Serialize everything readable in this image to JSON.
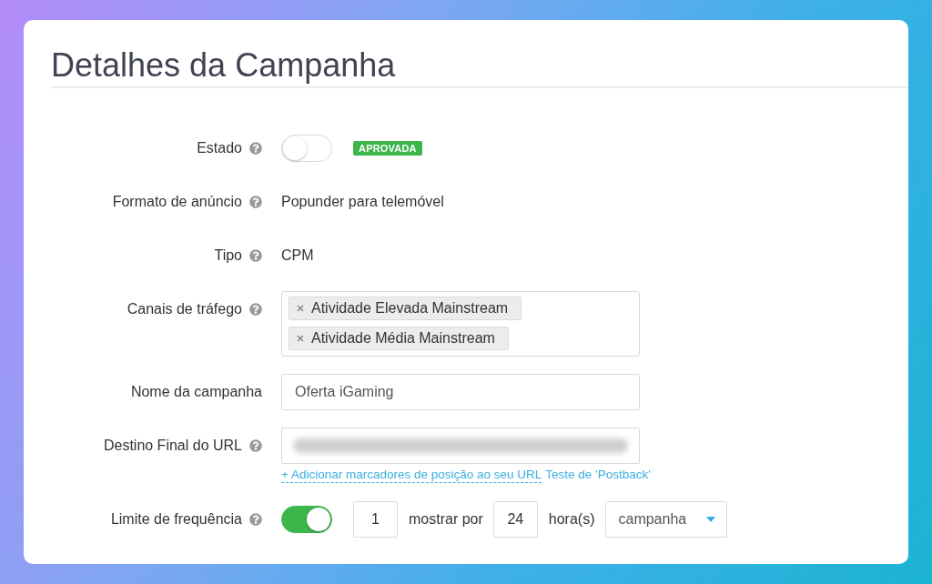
{
  "title": "Detalhes da Campanha",
  "rows": [
    {
      "kind": "toggle",
      "label": "Estado",
      "help": true,
      "on": false,
      "badge": "APROVADA"
    },
    {
      "kind": "text",
      "label": "Formato de anúncio",
      "help": true,
      "value": "Popunder para telemóvel"
    },
    {
      "kind": "text",
      "label": "Tipo",
      "help": true,
      "value": "CPM"
    },
    {
      "kind": "tags",
      "label": "Canais de tráfego",
      "help": true,
      "tags": [
        "Atividade Elevada Mainstream",
        "Atividade Média Mainstream"
      ]
    },
    {
      "kind": "input",
      "label": "Nome da campanha",
      "help": false,
      "value": "Oferta iGaming"
    },
    {
      "kind": "url",
      "label": "Destino Final do URL",
      "help": true,
      "links": [
        {
          "text": "+ Adicionar marcadores de posição ao seu URL",
          "underlined": true
        },
        {
          "text": "Teste de 'Postback'",
          "underlined": false
        }
      ]
    },
    {
      "kind": "frequency",
      "label": "Limite de frequência",
      "help": true,
      "on": true,
      "count": "1",
      "per_text": "mostrar por",
      "hours": "24",
      "unit_text": "hora(s)",
      "scope": "campanha"
    }
  ]
}
